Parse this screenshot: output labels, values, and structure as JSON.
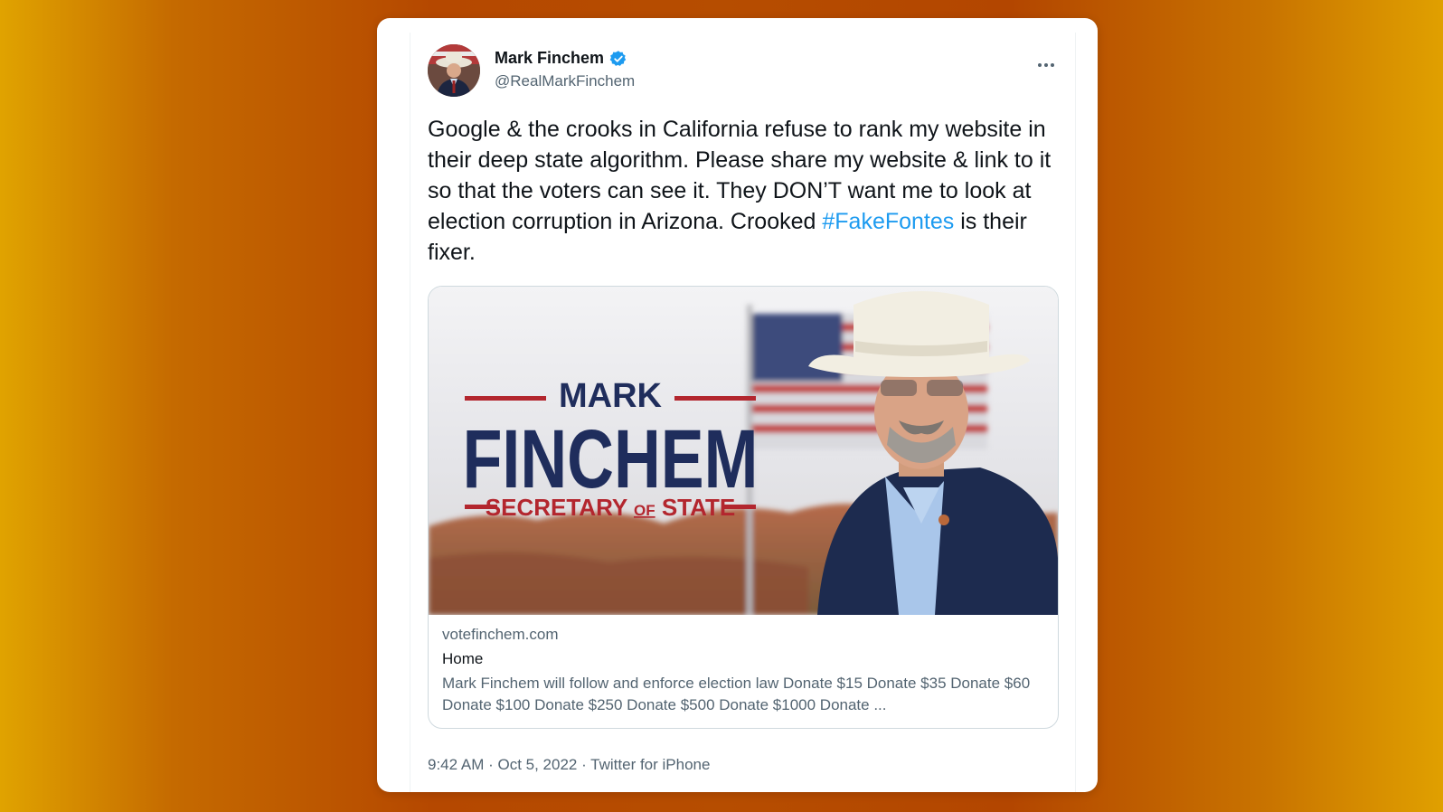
{
  "tweet": {
    "author_name": "Mark Finchem",
    "handle": "@RealMarkFinchem",
    "verified_icon": "verified-badge-icon",
    "more_icon": "more-options-icon",
    "text_before": "Google & the crooks in California refuse to rank my website in their deep state algorithm. Please share my website & link to it so that the voters can see it. They DON’T want me to look at election corruption in Arizona. Crooked ",
    "hashtag": "#FakeFontes",
    "text_after": " is their fixer.",
    "timestamp": "9:42 AM · Oct 5, 2022 · Twitter for iPhone"
  },
  "link_card": {
    "banner_first": "MARK",
    "banner_last": "FINCHEM",
    "banner_sub_a": "SECRETARY ",
    "banner_sub_of": "OF",
    "banner_sub_b": " STATE",
    "domain": "votefinchem.com",
    "title": "Home",
    "description": "Mark Finchem will follow and enforce election law Donate $15 Donate $35 Donate $60 Donate $100 Donate $250 Donate $500 Donate $1000 Donate ..."
  },
  "colors": {
    "hashtag": "#1d9bf0",
    "verified": "#1d9bf0",
    "banner_navy": "#1f2d5c",
    "banner_red": "#b3262e"
  }
}
